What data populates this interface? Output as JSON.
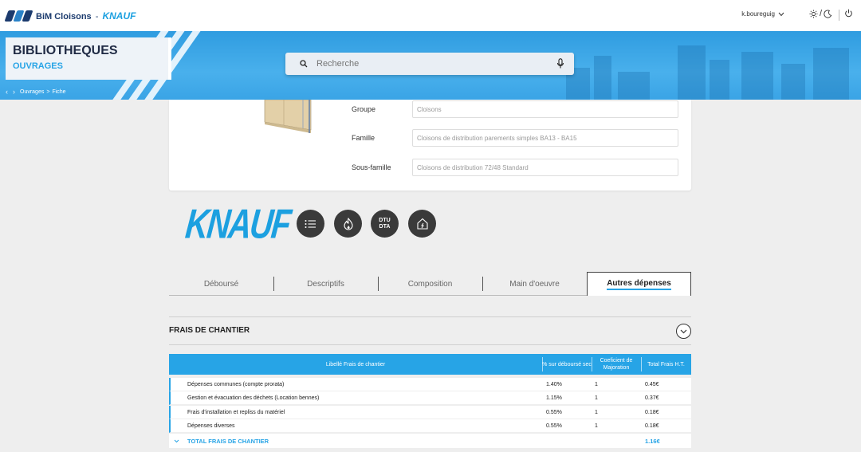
{
  "app": {
    "logo_text": "BiM Cloisons",
    "logo_sep": "-",
    "logo_brand": "KNAUF"
  },
  "header": {
    "username": "k.boureguig",
    "theme_sep": "/"
  },
  "banner": {
    "title": "BIBLIOTHEQUES",
    "subtitle": "OUVRAGES",
    "breadcrumb": [
      "Ouvrages",
      ">",
      "Fiche"
    ]
  },
  "search": {
    "placeholder": "Recherche"
  },
  "details": {
    "fields": [
      {
        "label": "Groupe",
        "value": "Cloisons"
      },
      {
        "label": "Famille",
        "value": "Cloisons de distribution parements simples BA13 - BA15"
      },
      {
        "label": "Sous-famille",
        "value": "Cloisons de distribution 72/48 Standard"
      }
    ]
  },
  "brand_logo": "KNAUF",
  "action_icons": {
    "list": "list-icon",
    "fire": "fire-icon",
    "dtu_line1": "DTU",
    "dtu_line2": "DTA",
    "house": "house-icon"
  },
  "tabs": [
    {
      "label": "Déboursé",
      "active": false
    },
    {
      "label": "Descriptifs",
      "active": false
    },
    {
      "label": "Composition",
      "active": false
    },
    {
      "label": "Main d'oeuvre",
      "active": false
    },
    {
      "label": "Autres dépenses",
      "active": true
    }
  ],
  "section": {
    "title": "FRAIS DE CHANTIER"
  },
  "table": {
    "headers": {
      "label": "Libellé Frais de chantier",
      "percent": "% sur déboursé sec",
      "coef": "Coeficient de Majoration",
      "total": "Total Frais H.T."
    },
    "rows": [
      {
        "label": "Dépenses communes (compte prorata)",
        "percent": "1.40%",
        "coef": "1",
        "total": "0.45€"
      },
      {
        "label": "Gestion et évacuation des déchets (Location bennes)",
        "percent": "1.15%",
        "coef": "1",
        "total": "0.37€"
      },
      {
        "label": "Frais d'installation et repliss du matériel",
        "percent": "0.55%",
        "coef": "1",
        "total": "0.18€"
      },
      {
        "label": "Dépenses diverses",
        "percent": "0.55%",
        "coef": "1",
        "total": "0.18€"
      }
    ],
    "total": {
      "label": "TOTAL FRAIS DE CHANTIER",
      "value": "1.16€"
    }
  },
  "colors": {
    "accent": "#27a4e6",
    "banner": "#3aa4e6",
    "dark_button": "#3a3a3a"
  }
}
